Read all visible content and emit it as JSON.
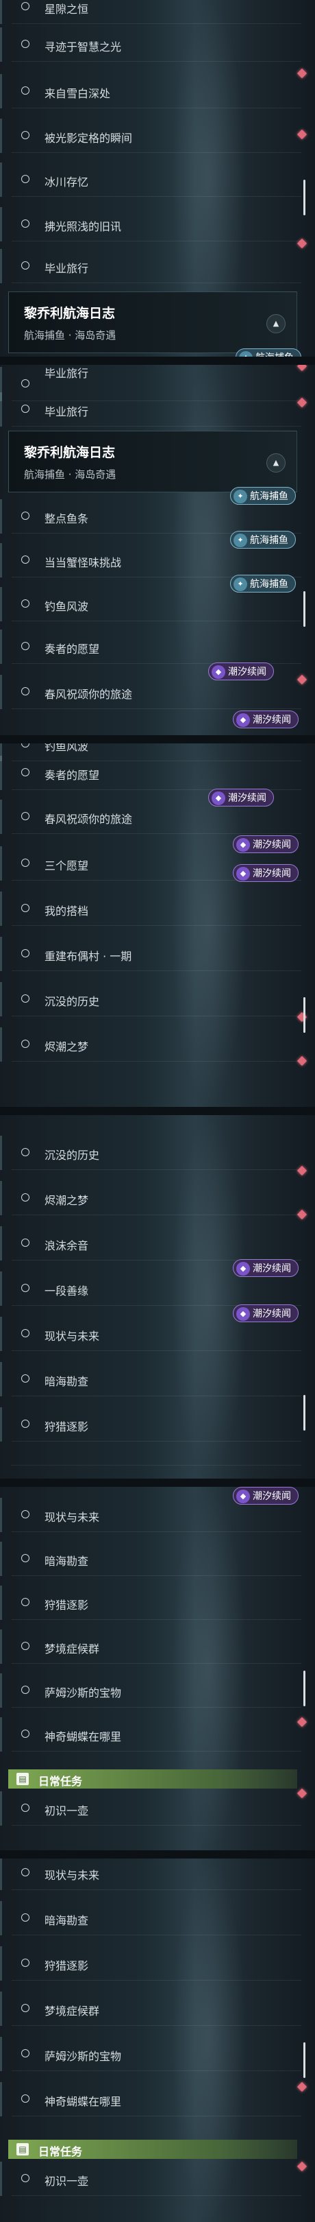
{
  "labels": {
    "item_0": "星隙之恒",
    "item_1": "寻迹于智慧之光",
    "item_2": "来自雪白深处",
    "item_3": "被光影定格的瞬间",
    "item_4": "冰川存忆",
    "item_5": "拂光照浅的旧讯",
    "item_6": "毕业旅行",
    "item_7": "整点鱼条",
    "item_8": "当当蟹怪味挑战",
    "item_9": "钓鱼风波",
    "item_10": "奏者的愿望",
    "item_11": "春风祝颂你的旅途",
    "item_12": "三个愿望",
    "item_13": "我的搭档",
    "item_14": "重建布偶村 · 一期",
    "item_15": "沉没的历史",
    "item_16": "烬潮之梦",
    "item_17": "浪沫余音",
    "item_18": "一段善缘",
    "item_19": "现状与未来",
    "item_20": "暗海勘查",
    "item_21": "狩猎逐影",
    "item_22": "梦境症候群",
    "item_23": "萨姆沙斯的宝物",
    "item_24": "神奇蝴蝶在哪里",
    "item_25": "初识一壶",
    "item_26": "钓鱼风波"
  },
  "header": {
    "title": "黎乔利航海日志",
    "subtitle": "航海捕鱼 · 海岛奇遇"
  },
  "tags": {
    "fishing": "航海捕鱼",
    "tide": "潮汐续闻"
  },
  "daily": {
    "label": "日常任务"
  },
  "colors": {
    "accent_red": "#e06a7a",
    "tag_purple": "#7a55c9",
    "tag_blue": "#4e8aa0",
    "daily_green": "#7fa852"
  }
}
